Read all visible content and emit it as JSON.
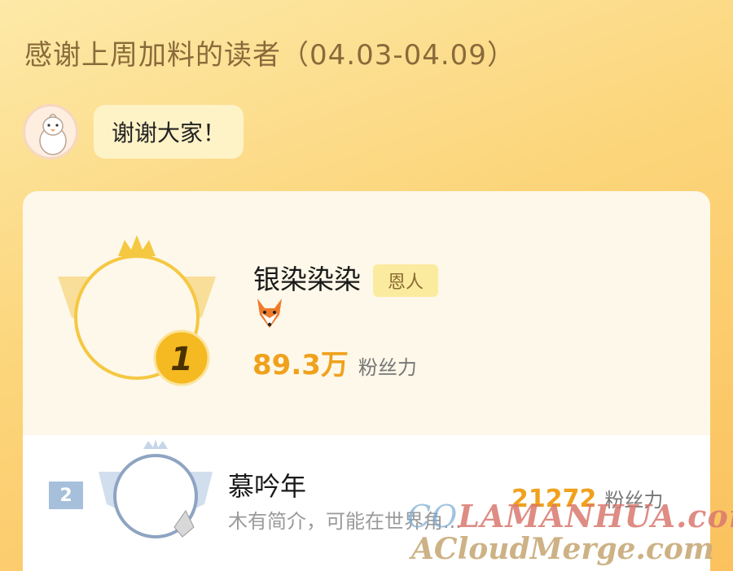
{
  "header": {
    "title": "感谢上周加料的读者（04.03-04.09）"
  },
  "message": {
    "avatar_icon": "chick-icon",
    "text": "谢谢大家！"
  },
  "ranking": {
    "first": {
      "rank": "1",
      "name": "银染染染",
      "badge": "恩人",
      "icon": "fox-icon",
      "fans_value": "89.3万",
      "fans_label": "粉丝力"
    },
    "second": {
      "rank": "2",
      "name": "慕吟年",
      "description": "木有简介，可能在世界角...",
      "fans_value": "21272",
      "fans_label": "粉丝力"
    }
  },
  "watermarks": {
    "line1_prefix": "CO",
    "line1": "LAMANHUA.com",
    "line2": "ACloudMerge.com"
  },
  "colors": {
    "gold": "#f0a11c",
    "silver": "#a6bfdb"
  }
}
